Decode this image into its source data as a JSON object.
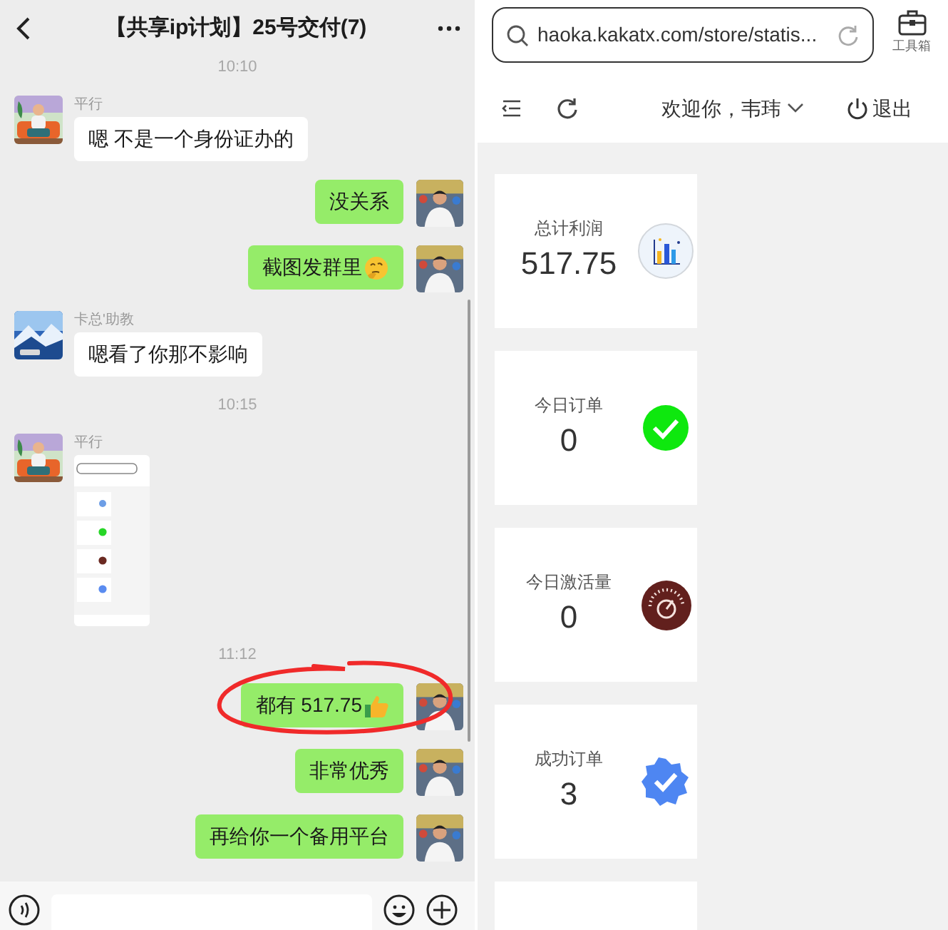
{
  "chat": {
    "title": "【共享ip计划】25号交付(7)",
    "messages": [
      {
        "kind": "time",
        "text": "10:10"
      },
      {
        "kind": "incoming",
        "sender": "平行",
        "text": "嗯 不是一个身份证办的"
      },
      {
        "kind": "outgoing",
        "text": "没关系",
        "circled": false
      },
      {
        "kind": "outgoing",
        "text": "截图发群里",
        "circled": false
      },
      {
        "kind": "incoming",
        "sender": "卡总'助教",
        "text": "嗯看了你那不影响"
      },
      {
        "kind": "time",
        "text": "10:15"
      },
      {
        "sender": "平行"
      },
      {
        "kind": "time",
        "text": "11:12"
      },
      {
        "kind": "outgoing",
        "text": "都有 517.75",
        "circled": true
      },
      {
        "kind": "outgoing",
        "text": "非常优秀",
        "circled": false
      },
      {
        "kind": "outgoing",
        "text": "再给你一个备用平台",
        "circled": false
      }
    ]
  },
  "browser": {
    "url": "haoka.kakatx.com/store/statis...",
    "toolbox_label": "工具箱",
    "welcome": "欢迎你，韦玮",
    "logout": "退出",
    "cards": [
      {
        "label": "总计利润",
        "value": "517.75"
      },
      {
        "label": "今日订单",
        "value": "0"
      },
      {
        "label": "今日激活量",
        "value": "0"
      },
      {
        "label": "成功订单",
        "value": "3"
      }
    ],
    "partial_card": true
  }
}
